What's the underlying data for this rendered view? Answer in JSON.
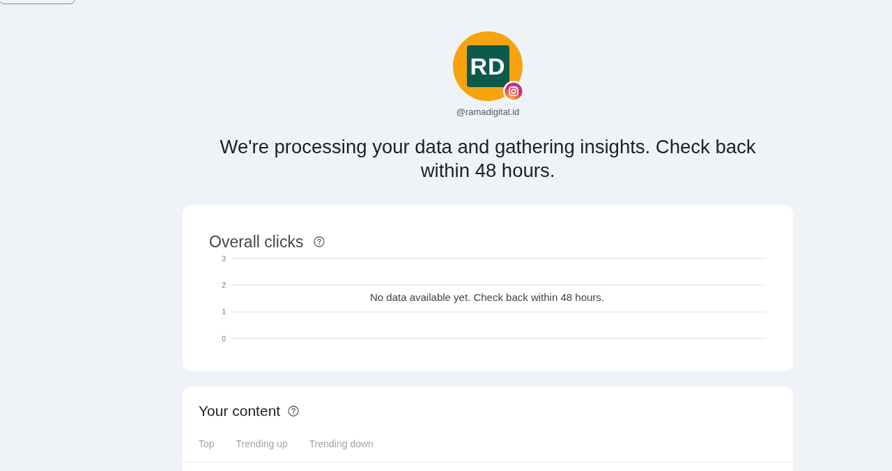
{
  "profile": {
    "initials": "RD",
    "handle": "@ramadigital.id"
  },
  "headline": "We're processing your data and gathering insights. Check back within 48 hours.",
  "overall_clicks": {
    "title": "Overall clicks",
    "y_axis_labels": [
      "3",
      "2",
      "1",
      "0"
    ],
    "empty_message": "No data available yet. Check back within 48 hours."
  },
  "your_content": {
    "title": "Your content",
    "tabs": [
      {
        "label": "Top",
        "selected": false,
        "disabled": true
      },
      {
        "label": "Trending up",
        "selected": false,
        "disabled": true
      },
      {
        "label": "Trending down",
        "selected": false,
        "disabled": true
      }
    ]
  }
}
